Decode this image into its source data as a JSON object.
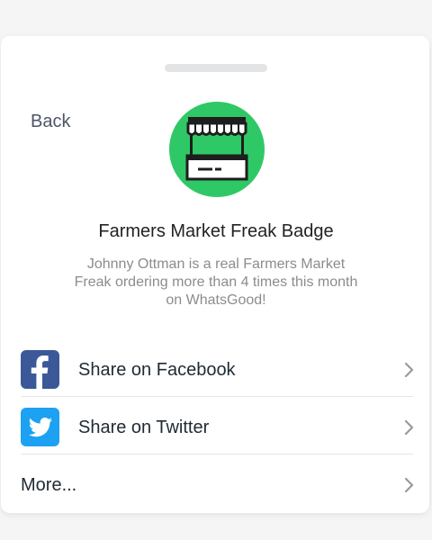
{
  "nav": {
    "back_label": "Back"
  },
  "badge": {
    "icon": "market-stall-icon",
    "title": "Farmers Market Freak Badge",
    "description": "Johnny Ottman is a real Farmers Market Freak ordering more than 4 times this month on WhatsGood!"
  },
  "share": {
    "items": [
      {
        "label": "Share on Facebook",
        "icon": "facebook-icon",
        "color": "#3b5998"
      },
      {
        "label": "Share on Twitter",
        "icon": "twitter-icon",
        "color": "#1da1f2"
      },
      {
        "label": "More...",
        "icon": "chevron-right-icon"
      }
    ]
  },
  "colors": {
    "badge_green": "#2fc866",
    "facebook_blue": "#3b5998",
    "twitter_blue": "#1da1f2"
  }
}
